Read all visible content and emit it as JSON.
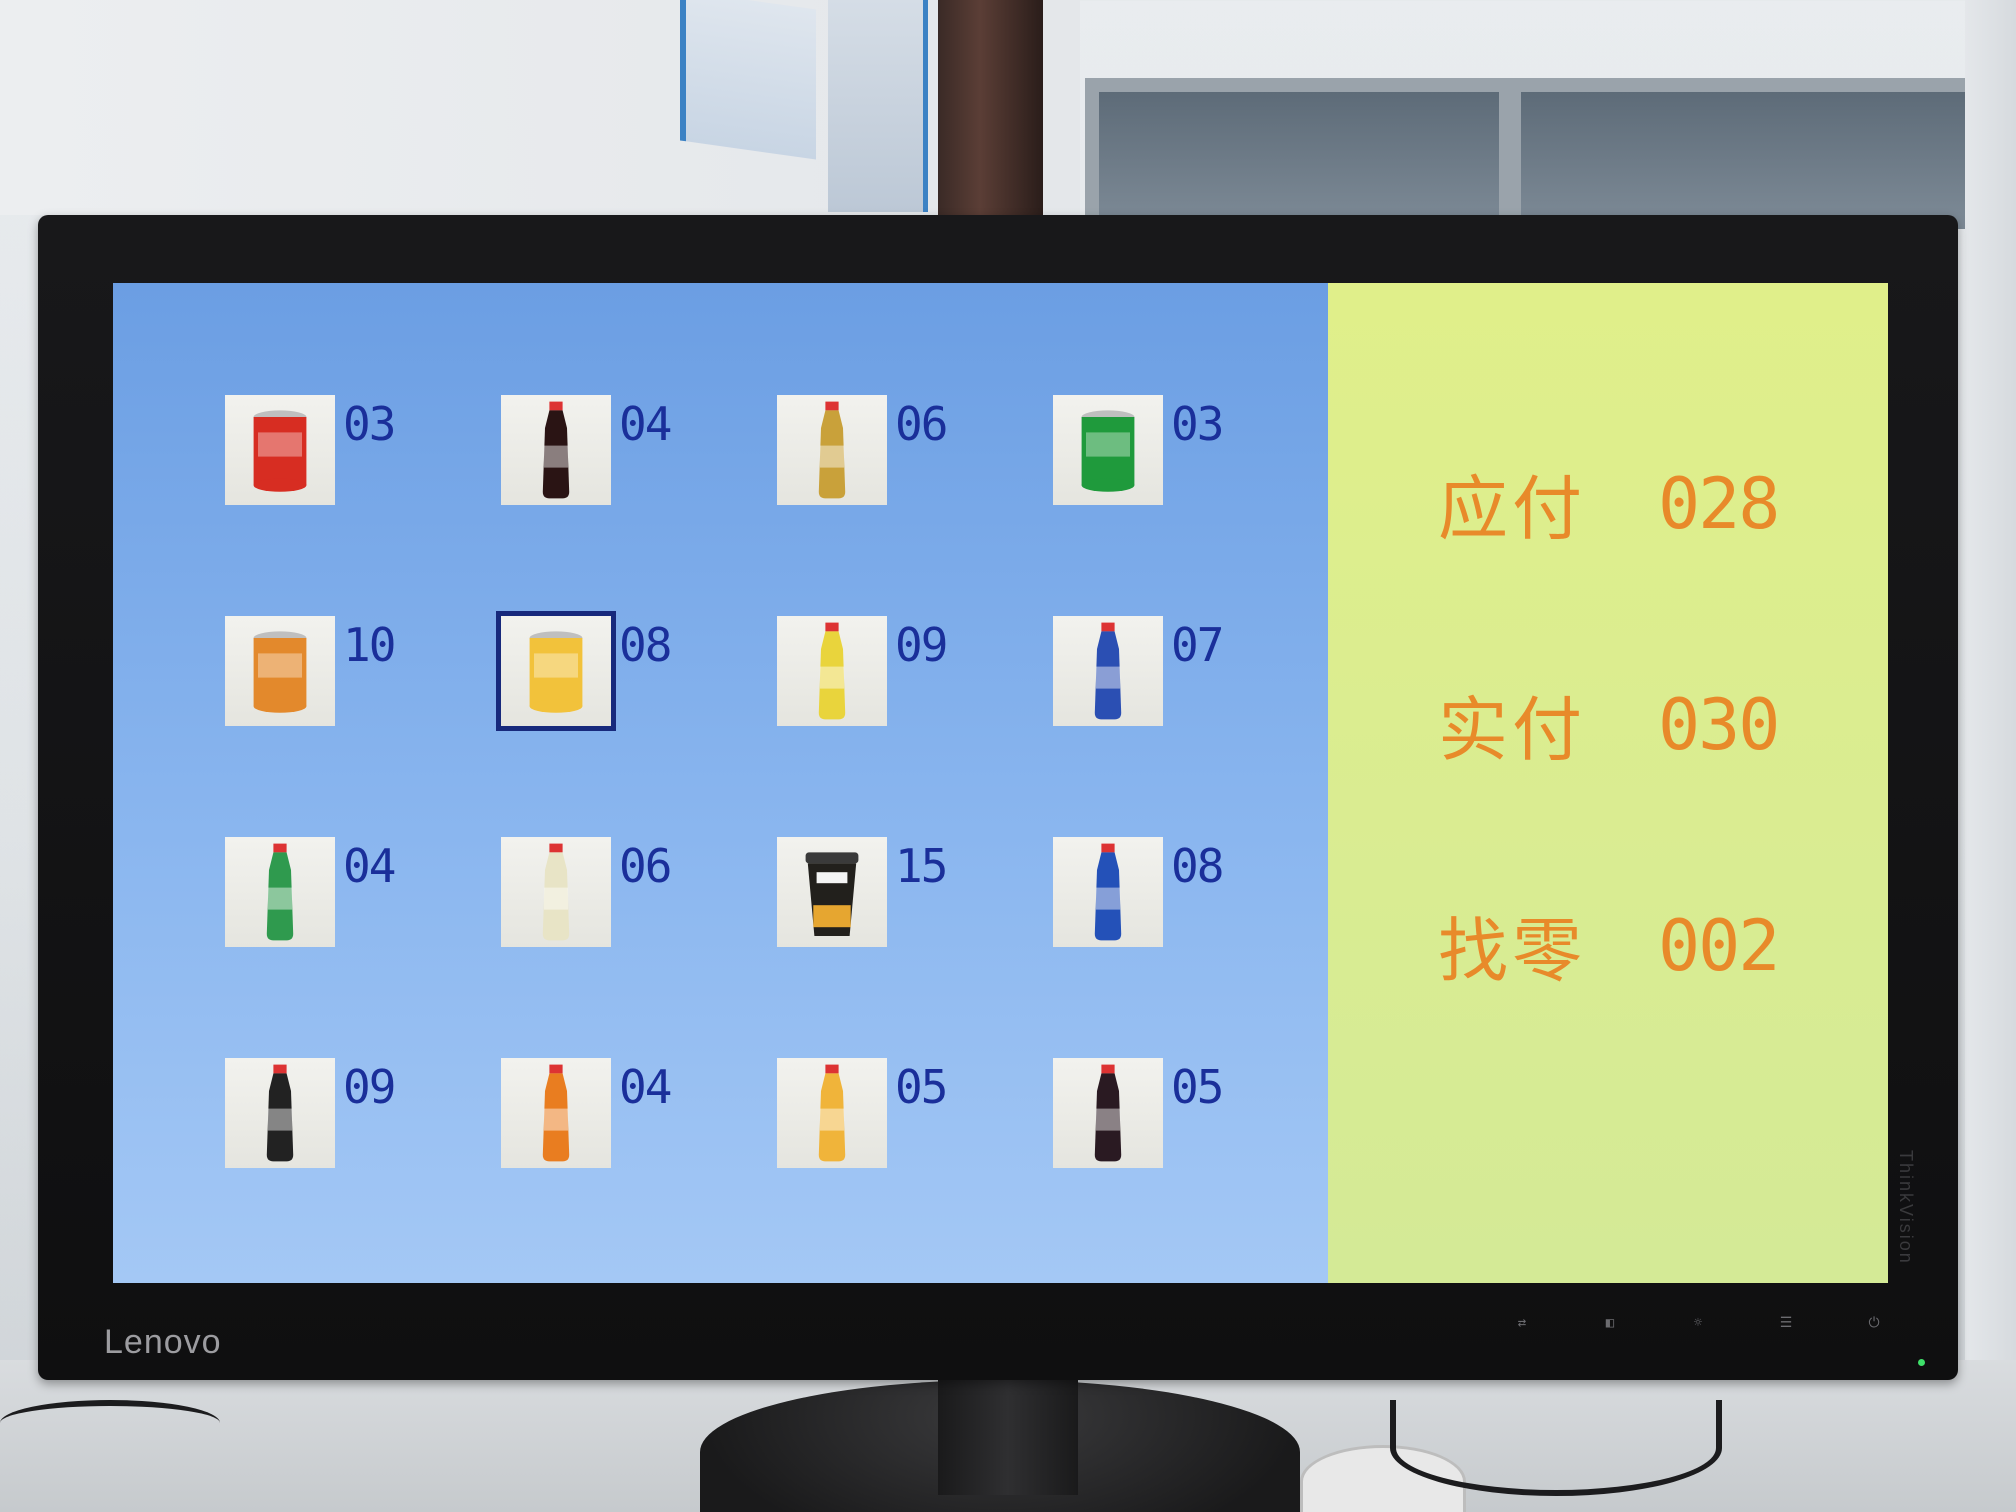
{
  "monitor": {
    "brand": "Lenovo",
    "side_brand": "ThinkVision"
  },
  "products": [
    {
      "icon": "cola-can-icon",
      "price": "03",
      "color": "#d72d22",
      "kind": "can"
    },
    {
      "icon": "cola-bottle-icon",
      "price": "04",
      "color": "#2a1414",
      "kind": "bottle"
    },
    {
      "icon": "tea-bottle-icon",
      "price": "06",
      "color": "#c9a13a",
      "kind": "bottle"
    },
    {
      "icon": "snow-beer-can-icon",
      "price": "03",
      "color": "#1f9a3c",
      "kind": "can"
    },
    {
      "icon": "orange-soda-can-icon",
      "price": "10",
      "color": "#e3892c",
      "kind": "can"
    },
    {
      "icon": "pellegrino-can-icon",
      "price": "08",
      "color": "#f2c23b",
      "kind": "can"
    },
    {
      "icon": "lemon-bottle-icon",
      "price": "09",
      "color": "#e9d43c",
      "kind": "bottle"
    },
    {
      "icon": "energy-drink-bottle-icon",
      "price": "07",
      "color": "#2b4fb3",
      "kind": "bottle"
    },
    {
      "icon": "sprite-bottle-icon",
      "price": "04",
      "color": "#2f9a4e",
      "kind": "bottle"
    },
    {
      "icon": "lemon-water-bottle-icon",
      "price": "06",
      "color": "#e8e4c6",
      "kind": "bottle"
    },
    {
      "icon": "milk-tea-cup-icon",
      "price": "15",
      "color": "#22201c",
      "kind": "cup"
    },
    {
      "icon": "sports-drink-bottle-icon",
      "price": "08",
      "color": "#2451b8",
      "kind": "bottle"
    },
    {
      "icon": "nfc-juice-bottle-icon",
      "price": "09",
      "color": "#222222",
      "kind": "bottle"
    },
    {
      "icon": "orange-drink-bottle-icon",
      "price": "04",
      "color": "#e97d20",
      "kind": "bottle"
    },
    {
      "icon": "juice-bottle-icon",
      "price": "05",
      "color": "#f0b43a",
      "kind": "bottle"
    },
    {
      "icon": "cola-zero-bottle-icon",
      "price": "05",
      "color": "#2a1a22",
      "kind": "bottle"
    }
  ],
  "selected_index": 5,
  "summary": {
    "due_label": "应付",
    "due_value": "028",
    "paid_label": "实付",
    "paid_value": "030",
    "change_label": "找零",
    "change_value": "002"
  },
  "colors": {
    "price_text": "#1a2f9a",
    "summary_text": "#e88a2a",
    "left_panel": "#7fadea",
    "right_panel": "#dcee90",
    "selection_border": "#17297c"
  }
}
